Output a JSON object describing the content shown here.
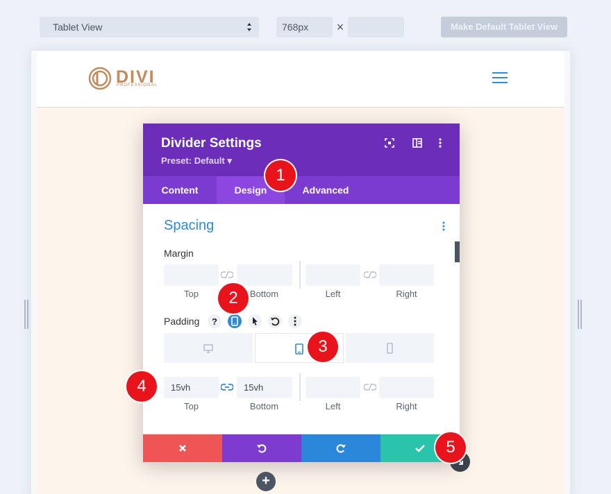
{
  "toolbar": {
    "view_select": "Tablet View",
    "width_value": "768px",
    "times_symbol": "×",
    "height_value": "",
    "make_default_label": "Make Default Tablet View"
  },
  "site": {
    "logo_word": "DIVI",
    "logo_sub": "PROFESSIONAL",
    "brand_color": "#c48a5b",
    "menu_icon": "hamburger-icon"
  },
  "modal": {
    "title": "Divider Settings",
    "preset": "Preset: Default ▾",
    "header_icons": [
      "focus-icon",
      "sidebar-layout-icon",
      "more-vertical-icon"
    ],
    "tabs": [
      {
        "label": "Content",
        "active": false
      },
      {
        "label": "Design",
        "active": true
      },
      {
        "label": "Advanced",
        "active": false
      }
    ],
    "section_title": "Spacing",
    "margin": {
      "label": "Margin",
      "top": "",
      "bottom": "",
      "left": "",
      "right": "",
      "captions": [
        "Top",
        "Bottom",
        "Left",
        "Right"
      ]
    },
    "padding": {
      "label": "Padding",
      "tools": [
        "help-icon",
        "tablet-icon",
        "cursor-icon",
        "reset-icon",
        "more-icon"
      ],
      "devices": [
        "desktop-icon",
        "tablet-icon",
        "phone-icon"
      ],
      "active_device": "tablet",
      "top": "15vh",
      "bottom": "15vh",
      "left": "",
      "right": "",
      "captions": [
        "Top",
        "Bottom",
        "Left",
        "Right"
      ]
    },
    "footer": [
      {
        "name": "discard-button",
        "icon": "close-icon",
        "color": "#ef5555"
      },
      {
        "name": "undo-button",
        "icon": "undo-icon",
        "color": "#7e3bd0"
      },
      {
        "name": "redo-button",
        "icon": "redo-icon",
        "color": "#2b87da"
      },
      {
        "name": "save-button",
        "icon": "check-icon",
        "color": "#29c4a9"
      }
    ]
  },
  "badges": [
    "1",
    "2",
    "3",
    "4",
    "5"
  ],
  "colors": {
    "header_purple": "#6c2eb9",
    "tab_purple": "#7c3bd0",
    "active_tab": "#8b47e0",
    "accent_blue": "#2e8ad8",
    "badge_red": "#e8131b"
  }
}
